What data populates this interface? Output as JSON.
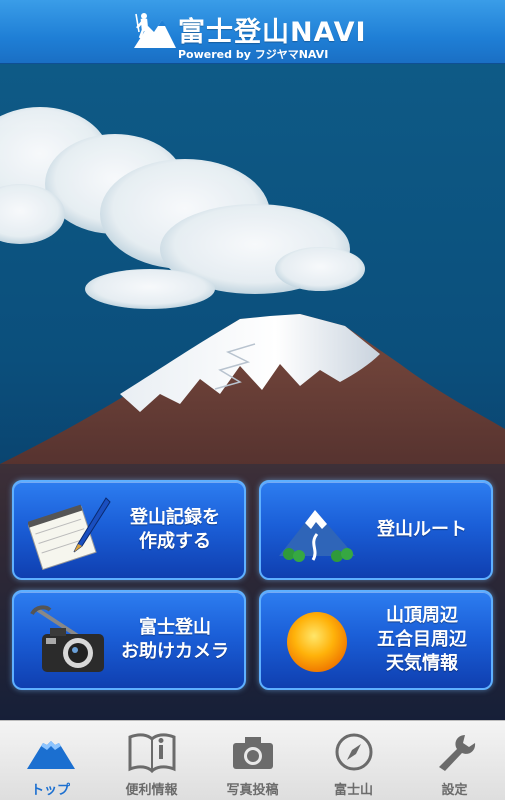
{
  "header": {
    "title": "富士登山NAVI",
    "subtitle": "Powered by フジヤマNAVI"
  },
  "menu": [
    {
      "id": "record",
      "icon": "notepad-pen-icon",
      "lines": [
        "登山記録を",
        "作成する"
      ]
    },
    {
      "id": "route",
      "icon": "mountain-route-icon",
      "lines": [
        "登山ルート"
      ]
    },
    {
      "id": "camera",
      "icon": "camera-pickaxe-icon",
      "lines": [
        "富士登山",
        "お助けカメラ"
      ]
    },
    {
      "id": "weather",
      "icon": "sun-icon",
      "lines": [
        "山頂周辺",
        "五合目周辺",
        "天気情報"
      ]
    }
  ],
  "tabs": [
    {
      "label": "トップ",
      "icon": "mountain-icon",
      "active": true
    },
    {
      "label": "便利情報",
      "icon": "book-info-icon",
      "active": false
    },
    {
      "label": "写真投稿",
      "icon": "camera-icon",
      "active": false
    },
    {
      "label": "富士山",
      "icon": "compass-icon",
      "active": false
    },
    {
      "label": "設定",
      "icon": "wrench-icon",
      "active": false
    }
  ],
  "colors": {
    "header": "#1f7fd6",
    "button": "#1b5fd8",
    "active_tab": "#1b6fd0"
  }
}
